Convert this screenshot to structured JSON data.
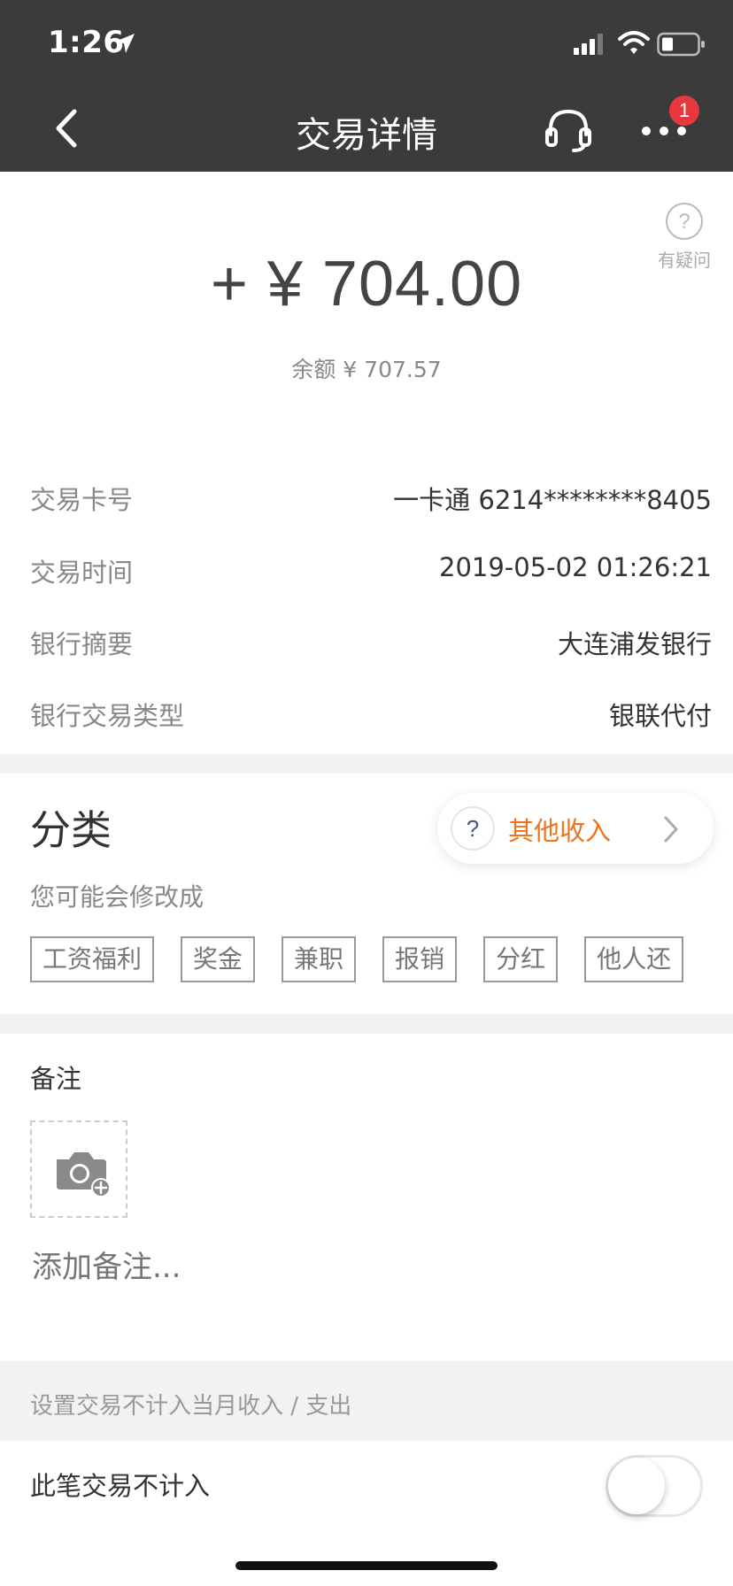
{
  "status_bar": {
    "time": "1:26"
  },
  "nav": {
    "title": "交易详情",
    "badge_count": "1"
  },
  "help": {
    "label": "有疑问"
  },
  "transaction": {
    "amount": "+ ¥ 704.00",
    "balance": "余额 ¥ 707.57"
  },
  "details": [
    {
      "label": "交易卡号",
      "value": "一卡通 6214********8405"
    },
    {
      "label": "交易时间",
      "value": "2019-05-02 01:26:21"
    },
    {
      "label": "银行摘要",
      "value": "大连浦发银行"
    },
    {
      "label": "银行交易类型",
      "value": "银联代付"
    }
  ],
  "category": {
    "title": "分类",
    "value": "其他收入",
    "value_color": "#f0731c",
    "hint": "您可能会修改成",
    "tags": [
      "工资福利",
      "奖金",
      "兼职",
      "报销",
      "分红",
      "他人还"
    ]
  },
  "note": {
    "title": "备注",
    "placeholder": "添加备注..."
  },
  "exclude": {
    "section_label": "设置交易不计入当月收入 / 支出",
    "toggle_label": "此笔交易不计入",
    "toggle_on": false
  },
  "icons": [
    "location-arrow-icon",
    "signal-icon",
    "wifi-icon",
    "battery-icon",
    "back-icon",
    "headset-icon",
    "more-icon",
    "question-icon",
    "chevron-right-icon",
    "camera-add-icon"
  ]
}
